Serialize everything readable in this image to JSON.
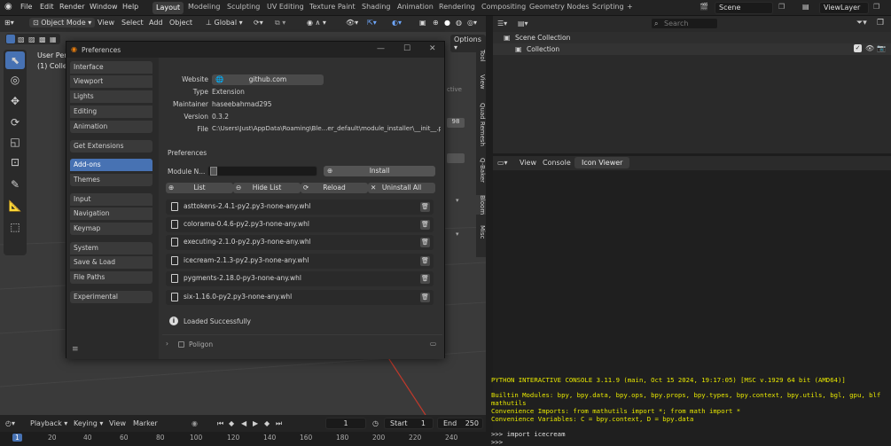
{
  "menu": {
    "items": [
      "File",
      "Edit",
      "Render",
      "Window",
      "Help"
    ]
  },
  "workspaces": [
    "Layout",
    "Modeling",
    "Sculpting",
    "UV Editing",
    "Texture Paint",
    "Shading",
    "Animation",
    "Rendering",
    "Compositing",
    "Geometry Nodes",
    "Scripting"
  ],
  "scene": "Scene",
  "view_layer": "ViewLayer",
  "viewport": {
    "mode": "Object Mode",
    "view": "View",
    "select": "Select",
    "add": "Add",
    "object": "Object",
    "orientation": "Global",
    "options": "Options",
    "overlay_title": "User Pers",
    "overlay_collection": "(1) Colle",
    "side_tabs": [
      "Tool",
      "View",
      "Quad Remesh",
      "Q-Baker",
      "Bloom",
      "Misc"
    ],
    "right_labels": [
      "ctive",
      "98"
    ]
  },
  "prefs": {
    "title": "Preferences",
    "nav": {
      "g1": [
        "Interface",
        "Viewport",
        "Lights",
        "Editing",
        "Animation"
      ],
      "g2": [
        "Get Extensions"
      ],
      "g3": [
        "Add-ons",
        "Themes"
      ],
      "g4": [
        "Input",
        "Navigation",
        "Keymap"
      ],
      "g5": [
        "System",
        "Save & Load",
        "File Paths"
      ],
      "g6": [
        "Experimental"
      ]
    },
    "info": {
      "website_label": "Website",
      "website": "github.com",
      "type_label": "Type",
      "type": "Extension",
      "maintainer_label": "Maintainer",
      "maintainer": "haseebahmad295",
      "version_label": "Version",
      "version": "0.3.2",
      "file_label": "File",
      "file": "C:\\Users\\Just\\AppData\\Roaming\\Ble...er_default\\module_installer\\__init__.py"
    },
    "section": "Preferences",
    "module_label": "Module N...",
    "install": "Install",
    "actions": {
      "list": "List",
      "hide": "Hide List",
      "reload": "Reload",
      "uninstall": "Uninstall All"
    },
    "modules": [
      "asttokens-2.4.1-py2.py3-none-any.whl",
      "colorama-0.4.6-py2.py3-none-any.whl",
      "executing-2.1.0-py2.py3-none-any.whl",
      "icecream-2.1.3-py2.py3-none-any.whl",
      "pygments-2.18.0-py3-none-any.whl",
      "six-1.16.0-py2.py3-none-any.whl"
    ],
    "status": "Loaded Successfully",
    "subpanel": "Poligon"
  },
  "outliner": {
    "search_placeholder": "Search",
    "scene_collection": "Scene Collection",
    "collection": "Collection"
  },
  "console": {
    "view": "View",
    "console": "Console",
    "icon_viewer": "Icon Viewer",
    "lines": [
      "PYTHON INTERACTIVE CONSOLE 3.11.9 (main, Oct 15 2024, 19:17:05) [MSC v.1929 64 bit (AMD64)]",
      "Builtin Modules:       bpy, bpy.data, bpy.ops, bpy.props, bpy.types, bpy.context, bpy.utils, bgl, gpu, blf",
      "mathutils",
      "Convenience Imports:   from mathutils import *; from math import *",
      "Convenience Variables: C = bpy.context, D = bpy.data",
      ">>> import icecream",
      ">>>"
    ]
  },
  "timeline": {
    "playback": "Playback",
    "keying": "Keying",
    "view": "View",
    "marker": "Marker",
    "current": "1",
    "start_label": "Start",
    "start": "1",
    "end_label": "End",
    "end": "250",
    "frames": [
      "1",
      "20",
      "40",
      "60",
      "80",
      "100",
      "120",
      "140",
      "160",
      "180",
      "200",
      "220",
      "240"
    ]
  }
}
